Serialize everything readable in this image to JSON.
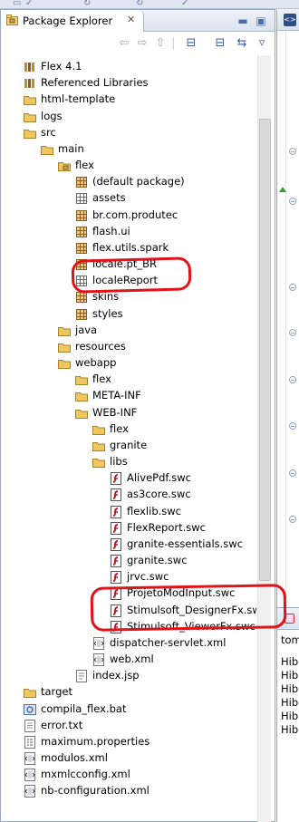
{
  "panel": {
    "title": "Package Explorer",
    "close_glyph": "✕"
  },
  "tree": [
    {
      "label": "Flex 4.1",
      "icon": "library-icon",
      "indent": 0
    },
    {
      "label": "Referenced Libraries",
      "icon": "library-icon",
      "indent": 0
    },
    {
      "label": "html-template",
      "icon": "folder-icon",
      "indent": 0
    },
    {
      "label": "logs",
      "icon": "folder-icon",
      "indent": 0
    },
    {
      "label": "src",
      "icon": "folder-icon",
      "indent": 0
    },
    {
      "label": "main",
      "icon": "folder-icon",
      "indent": 1
    },
    {
      "label": "flex",
      "icon": "source-folder-icon",
      "indent": 2
    },
    {
      "label": "(default package)",
      "icon": "package-icon",
      "indent": 3
    },
    {
      "label": "assets",
      "icon": "package-empty-icon",
      "indent": 3
    },
    {
      "label": "br.com.produtec",
      "icon": "package-icon",
      "indent": 3
    },
    {
      "label": "flash.ui",
      "icon": "package-icon",
      "indent": 3
    },
    {
      "label": "flex.utils.spark",
      "icon": "package-icon",
      "indent": 3
    },
    {
      "label": "locale.pt_BR",
      "icon": "package-icon",
      "indent": 3
    },
    {
      "label": "localeReport",
      "icon": "package-empty-icon",
      "indent": 3
    },
    {
      "label": "skins",
      "icon": "package-icon",
      "indent": 3
    },
    {
      "label": "styles",
      "icon": "package-icon",
      "indent": 3
    },
    {
      "label": "java",
      "icon": "folder-icon",
      "indent": 2
    },
    {
      "label": "resources",
      "icon": "folder-icon",
      "indent": 2
    },
    {
      "label": "webapp",
      "icon": "folder-icon",
      "indent": 2
    },
    {
      "label": "flex",
      "icon": "folder-icon",
      "indent": 3
    },
    {
      "label": "META-INF",
      "icon": "folder-icon",
      "indent": 3
    },
    {
      "label": "WEB-INF",
      "icon": "folder-icon",
      "indent": 3
    },
    {
      "label": "flex",
      "icon": "folder-icon",
      "indent": 4
    },
    {
      "label": "granite",
      "icon": "folder-icon",
      "indent": 4
    },
    {
      "label": "libs",
      "icon": "folder-icon",
      "indent": 4
    },
    {
      "label": "AlivePdf.swc",
      "icon": "flash-file-icon",
      "indent": 5
    },
    {
      "label": "as3core.swc",
      "icon": "flash-file-icon",
      "indent": 5
    },
    {
      "label": "flexlib.swc",
      "icon": "flash-file-icon",
      "indent": 5
    },
    {
      "label": "FlexReport.swc",
      "icon": "flash-file-icon",
      "indent": 5
    },
    {
      "label": "granite-essentials.swc",
      "icon": "flash-file-icon",
      "indent": 5
    },
    {
      "label": "granite.swc",
      "icon": "flash-file-icon",
      "indent": 5
    },
    {
      "label": "jrvc.swc",
      "icon": "flash-file-icon",
      "indent": 5
    },
    {
      "label": "ProjetoModInput.swc",
      "icon": "flash-file-icon",
      "indent": 5
    },
    {
      "label": "Stimulsoft_DesignerFx.swc",
      "icon": "flash-file-icon",
      "indent": 5
    },
    {
      "label": "Stimulsoft_ViewerFx.swc",
      "icon": "flash-file-icon",
      "indent": 5
    },
    {
      "label": "dispatcher-servlet.xml",
      "icon": "xml-file-icon",
      "indent": 4
    },
    {
      "label": "web.xml",
      "icon": "xml-file-icon",
      "indent": 4
    },
    {
      "label": "index.jsp",
      "icon": "jsp-file-icon",
      "indent": 3
    },
    {
      "label": "target",
      "icon": "folder-icon",
      "indent": 0
    },
    {
      "label": "compila_flex.bat",
      "icon": "bat-file-icon",
      "indent": 0
    },
    {
      "label": "error.txt",
      "icon": "text-file-icon",
      "indent": 0
    },
    {
      "label": "maximum.properties",
      "icon": "properties-file-icon",
      "indent": 0
    },
    {
      "label": "modulos.xml",
      "icon": "xml-file-icon",
      "indent": 0
    },
    {
      "label": "mxmlcconfig.xml",
      "icon": "xml-file-icon",
      "indent": 0
    },
    {
      "label": "nb-configuration.xml",
      "icon": "xml-file-icon",
      "indent": 0
    }
  ],
  "console": {
    "header": "tom",
    "lines": [
      "Hib",
      "Hib",
      "Hib",
      "Hib",
      "Hib",
      "Hib"
    ]
  },
  "colors": {
    "accent": "#3a5da2",
    "annotation": "#e0131a",
    "folder": "#e8b84a",
    "package": "#b98a3b"
  }
}
